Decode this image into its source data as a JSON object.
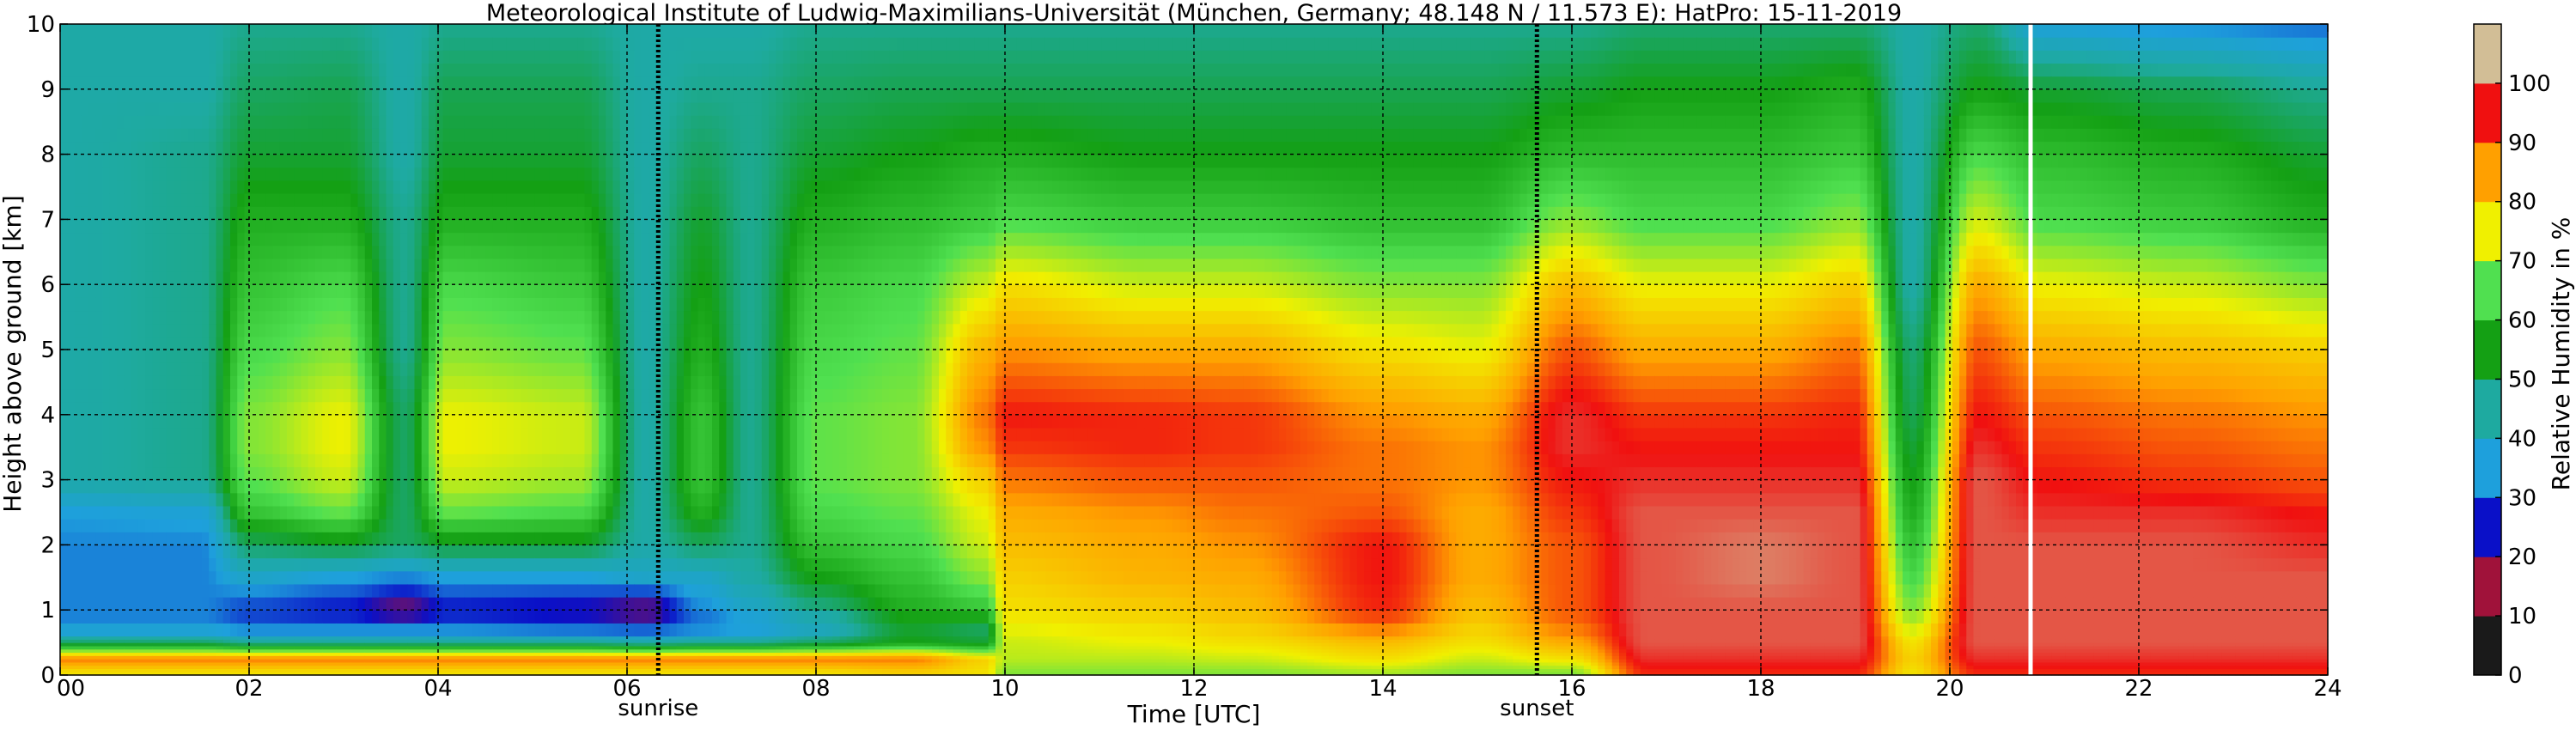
{
  "chart_data": {
    "type": "heatmap",
    "title": "Meteorological Institute of Ludwig-Maximilians-Universität (München, Germany; 48.148 N / 11.573 E):    HatPro: 15-11-2019",
    "xlabel": "Time [UTC]",
    "ylabel": "Height above ground [km]",
    "xlim": [
      0,
      24
    ],
    "ylim": [
      0,
      10
    ],
    "x_ticks": [
      "00",
      "02",
      "04",
      "06",
      "08",
      "10",
      "12",
      "14",
      "16",
      "18",
      "20",
      "22",
      "24"
    ],
    "y_ticks": [
      "0",
      "1",
      "2",
      "3",
      "4",
      "5",
      "6",
      "7",
      "8",
      "9",
      "10"
    ],
    "grid": true,
    "markers": [
      {
        "label": "sunrise",
        "x": 6.33
      },
      {
        "label": "sunset",
        "x": 15.63
      }
    ],
    "colorbar": {
      "label": "Relative Humidity in %",
      "ticks": [
        "0",
        "10",
        "20",
        "30",
        "40",
        "50",
        "60",
        "70",
        "80",
        "90",
        "100"
      ],
      "range": [
        0,
        100
      ],
      "colors": [
        "#1a1a1a",
        "#a0123a",
        "#0a10c8",
        "#1ea0dc",
        "#1eaaa0",
        "#14a014",
        "#50e050",
        "#f0f000",
        "#ffa000",
        "#f01010",
        "#d2be96"
      ]
    },
    "height_km": [
      0.05,
      0.25,
      0.5,
      0.75,
      1.0,
      1.5,
      2.0,
      2.5,
      3.0,
      3.5,
      4.0,
      5.0,
      6.0,
      7.0,
      8.0,
      9.0,
      10.0
    ],
    "profiles": [
      {
        "t": 0.0,
        "rh": [
          70,
          80,
          45,
          30,
          30,
          30,
          30,
          32,
          40,
          40,
          40,
          40,
          40,
          40,
          40,
          40,
          40
        ]
      },
      {
        "t": 1.5,
        "rh": [
          70,
          80,
          45,
          30,
          30,
          30,
          30,
          33,
          42,
          42,
          42,
          42,
          42,
          42,
          42,
          40,
          40
        ]
      },
      {
        "t": 2.0,
        "rh": [
          70,
          80,
          42,
          28,
          25,
          35,
          45,
          55,
          60,
          62,
          62,
          58,
          55,
          52,
          48,
          45,
          42
        ]
      },
      {
        "t": 3.0,
        "rh": [
          70,
          80,
          42,
          28,
          22,
          32,
          48,
          60,
          66,
          68,
          68,
          62,
          58,
          52,
          48,
          46,
          42
        ]
      },
      {
        "t": 3.65,
        "rh": [
          70,
          80,
          42,
          28,
          15,
          30,
          45,
          45,
          45,
          45,
          45,
          42,
          42,
          42,
          40,
          40,
          40
        ]
      },
      {
        "t": 4.1,
        "rh": [
          70,
          80,
          42,
          28,
          22,
          32,
          48,
          60,
          66,
          68,
          68,
          62,
          58,
          52,
          48,
          46,
          42
        ]
      },
      {
        "t": 5.5,
        "rh": [
          70,
          80,
          42,
          26,
          20,
          32,
          48,
          58,
          64,
          66,
          66,
          60,
          56,
          52,
          48,
          46,
          42
        ]
      },
      {
        "t": 6.2,
        "rh": [
          70,
          80,
          40,
          25,
          15,
          35,
          40,
          40,
          40,
          40,
          40,
          40,
          40,
          40,
          40,
          40,
          40
        ]
      },
      {
        "t": 6.8,
        "rh": [
          70,
          80,
          42,
          28,
          30,
          35,
          45,
          52,
          55,
          55,
          55,
          52,
          50,
          48,
          45,
          42,
          40
        ]
      },
      {
        "t": 7.3,
        "rh": [
          70,
          80,
          42,
          30,
          35,
          40,
          42,
          42,
          42,
          42,
          42,
          42,
          42,
          42,
          42,
          42,
          40
        ]
      },
      {
        "t": 8.0,
        "rh": [
          70,
          80,
          45,
          35,
          42,
          50,
          55,
          58,
          60,
          60,
          60,
          58,
          56,
          52,
          48,
          45,
          42
        ]
      },
      {
        "t": 9.0,
        "rh": [
          72,
          80,
          50,
          48,
          52,
          55,
          58,
          60,
          62,
          62,
          62,
          60,
          58,
          54,
          50,
          46,
          42
        ]
      },
      {
        "t": 9.8,
        "rh": [
          70,
          72,
          48,
          45,
          55,
          62,
          66,
          68,
          72,
          78,
          80,
          75,
          66,
          56,
          52,
          46,
          42
        ]
      },
      {
        "t": 10.0,
        "rh": [
          62,
          65,
          66,
          68,
          70,
          72,
          74,
          76,
          80,
          84,
          86,
          78,
          70,
          58,
          52,
          46,
          42
        ]
      },
      {
        "t": 11.5,
        "rh": [
          62,
          65,
          68,
          70,
          72,
          75,
          76,
          78,
          82,
          85,
          85,
          76,
          66,
          56,
          50,
          46,
          42
        ]
      },
      {
        "t": 12.5,
        "rh": [
          62,
          66,
          70,
          72,
          74,
          76,
          78,
          80,
          82,
          84,
          84,
          76,
          66,
          56,
          50,
          46,
          42
        ]
      },
      {
        "t": 14.0,
        "rh": [
          64,
          70,
          74,
          80,
          85,
          86,
          86,
          82,
          80,
          80,
          78,
          70,
          62,
          54,
          50,
          46,
          42
        ]
      },
      {
        "t": 15.0,
        "rh": [
          62,
          66,
          70,
          72,
          74,
          76,
          76,
          76,
          78,
          78,
          76,
          68,
          62,
          54,
          50,
          46,
          42
        ]
      },
      {
        "t": 16.0,
        "rh": [
          62,
          70,
          76,
          80,
          82,
          82,
          82,
          84,
          86,
          88,
          88,
          82,
          74,
          62,
          54,
          48,
          42
        ]
      },
      {
        "t": 16.8,
        "rh": [
          85,
          88,
          90,
          90,
          90,
          90,
          90,
          90,
          88,
          86,
          84,
          76,
          68,
          58,
          54,
          50,
          44
        ]
      },
      {
        "t": 18.0,
        "rh": [
          85,
          88,
          90,
          90,
          90,
          92,
          92,
          90,
          88,
          86,
          84,
          76,
          68,
          58,
          54,
          50,
          44
        ]
      },
      {
        "t": 19.0,
        "rh": [
          85,
          88,
          90,
          90,
          90,
          90,
          90,
          90,
          88,
          86,
          85,
          80,
          72,
          62,
          56,
          52,
          44
        ]
      },
      {
        "t": 19.6,
        "rh": [
          70,
          72,
          70,
          66,
          62,
          58,
          55,
          52,
          50,
          48,
          46,
          44,
          40,
          40,
          40,
          40,
          40
        ]
      },
      {
        "t": 20.3,
        "rh": [
          85,
          88,
          90,
          90,
          90,
          90,
          90,
          90,
          90,
          88,
          86,
          82,
          76,
          66,
          58,
          50,
          44
        ]
      },
      {
        "t": 21.0,
        "rh": [
          85,
          88,
          90,
          90,
          90,
          90,
          90,
          88,
          86,
          84,
          82,
          76,
          68,
          58,
          54,
          48,
          32
        ]
      },
      {
        "t": 22.5,
        "rh": [
          85,
          88,
          90,
          90,
          90,
          90,
          90,
          88,
          84,
          82,
          80,
          74,
          66,
          56,
          52,
          46,
          30
        ]
      },
      {
        "t": 24.0,
        "rh": [
          85,
          88,
          90,
          90,
          90,
          90,
          88,
          86,
          82,
          80,
          78,
          72,
          62,
          52,
          48,
          42,
          28
        ]
      }
    ],
    "data_gap_x": 20.85
  }
}
